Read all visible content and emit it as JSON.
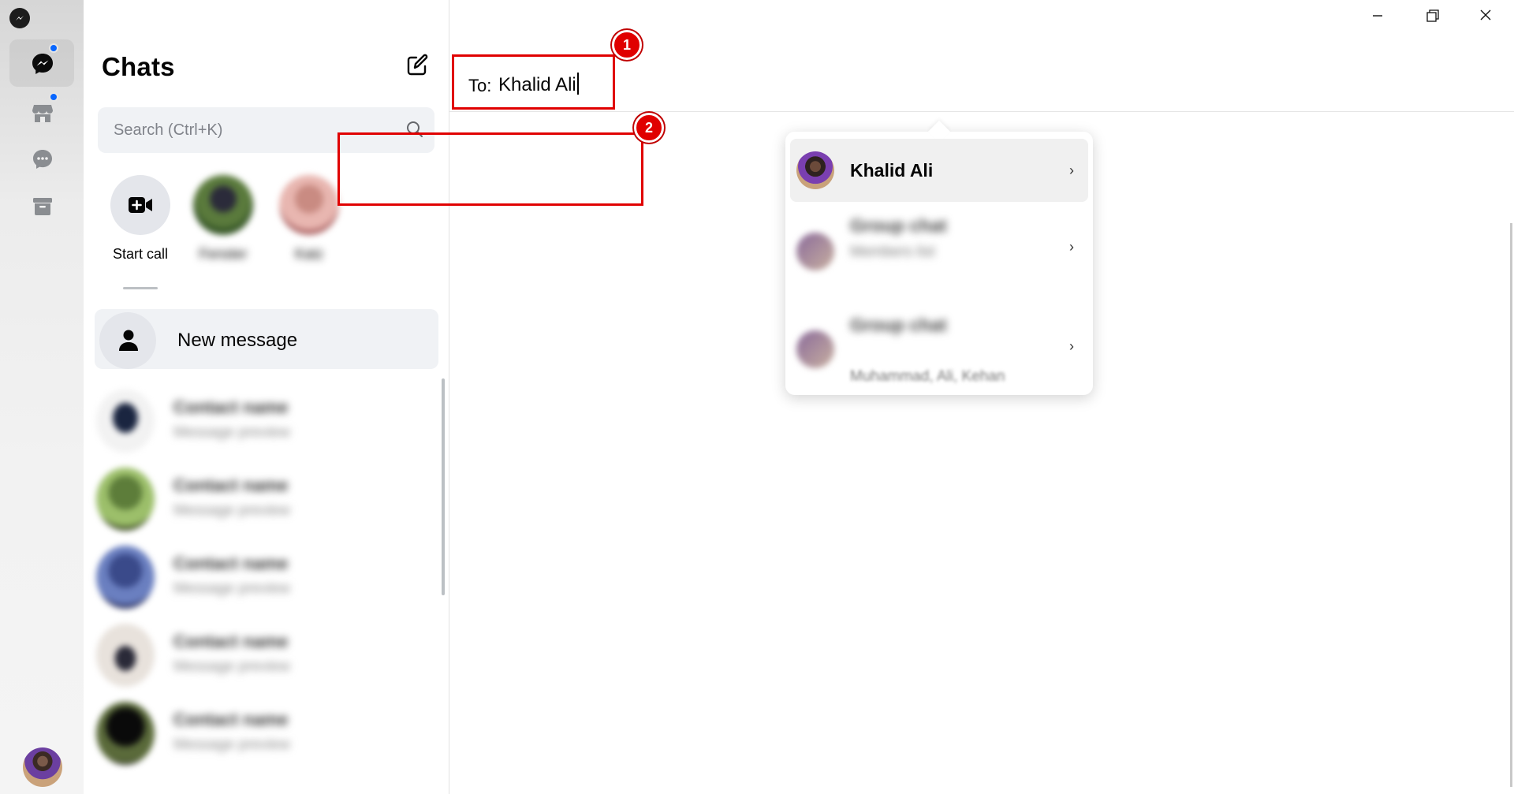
{
  "rail": {
    "logo_icon": "messenger-logo-icon",
    "items": [
      {
        "icon": "chat-bubble-icon",
        "active": true,
        "has_badge": true
      },
      {
        "icon": "marketplace-icon",
        "active": false,
        "has_badge": true
      },
      {
        "icon": "message-requests-icon",
        "active": false,
        "has_badge": false
      },
      {
        "icon": "archive-icon",
        "active": false,
        "has_badge": false
      }
    ],
    "badge_color": "#0866ff"
  },
  "sidebar": {
    "title": "Chats",
    "compose_icon": "compose-icon",
    "search_placeholder": "Search (Ctrl+K)",
    "stories": [
      {
        "label": "Start call",
        "icon": "video-call-icon"
      },
      {
        "label": "Fenster",
        "blurred": true
      },
      {
        "label": "Katz",
        "blurred": true
      }
    ],
    "new_message_label": "New message",
    "conversations": [
      {
        "name": "Contact name",
        "preview": "Message preview"
      },
      {
        "name": "Contact name",
        "preview": "Message preview"
      },
      {
        "name": "Contact name",
        "preview": "Message preview"
      },
      {
        "name": "Contact name",
        "preview": "Message preview"
      },
      {
        "name": "Contact name",
        "preview": "Message preview"
      }
    ]
  },
  "compose": {
    "to_label": "To:",
    "to_value": "Khalid Ali",
    "suggestions": [
      {
        "name": "Khalid Ali",
        "selected": true
      },
      {
        "name": "Group chat",
        "members": "Members list",
        "blurred": true
      },
      {
        "name": "Group chat",
        "members": "Muhammad, Ali, Kehan",
        "blurred": true
      }
    ]
  },
  "window": {
    "minimize_icon": "minimize-icon",
    "restore_icon": "restore-icon",
    "close_icon": "close-icon"
  },
  "annotations": {
    "badge1": "1",
    "badge2": "2",
    "color": "#e00000"
  }
}
